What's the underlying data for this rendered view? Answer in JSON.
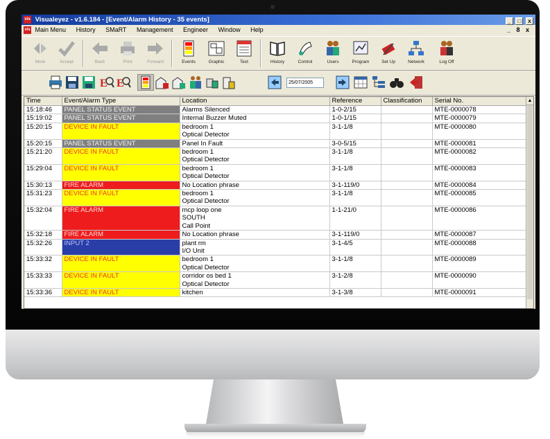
{
  "window": {
    "title": "Visualeyez - v1.6.184 - [Event/Alarm History - 35 events]",
    "app_badge": "vis",
    "buttons": [
      "_",
      "□",
      "x"
    ]
  },
  "menu": {
    "items": [
      "Main Menu",
      "History",
      "SMaRT",
      "Management",
      "Engineer",
      "Window",
      "Help"
    ],
    "mdi_controls": "_ 8 x"
  },
  "toolbar_main": [
    {
      "label": "Mute",
      "icon": "mute-icon",
      "enabled": false
    },
    {
      "label": "Accept",
      "icon": "checkmark-icon",
      "enabled": false
    },
    {
      "label": "Back",
      "icon": "arrow-left-icon",
      "enabled": false
    },
    {
      "label": "Print",
      "icon": "printer-icon",
      "enabled": false
    },
    {
      "label": "Forward",
      "icon": "arrow-right-icon",
      "enabled": false
    },
    {
      "label": "Events",
      "icon": "events-icon",
      "enabled": true
    },
    {
      "label": "Graphic",
      "icon": "graphic-icon",
      "enabled": true
    },
    {
      "label": "Text",
      "icon": "text-icon",
      "enabled": true
    },
    {
      "label": "History",
      "icon": "book-icon",
      "enabled": true
    },
    {
      "label": "Control",
      "icon": "control-icon",
      "enabled": true
    },
    {
      "label": "Users",
      "icon": "users-icon",
      "enabled": true
    },
    {
      "label": "Program",
      "icon": "program-icon",
      "enabled": true
    },
    {
      "label": "Set Up",
      "icon": "setup-icon",
      "enabled": true
    },
    {
      "label": "Network",
      "icon": "network-icon",
      "enabled": true
    },
    {
      "label": "Log Off",
      "icon": "logoff-icon",
      "enabled": true
    }
  ],
  "toolbar_history": {
    "date": "25/07/2005"
  },
  "grid": {
    "columns": [
      "Time",
      "Event/Alarm Type",
      "Location",
      "Reference",
      "Classification",
      "Serial No."
    ],
    "rows": [
      {
        "time": "15:18:46",
        "type": "PANEL STATUS EVENT",
        "kind": "panel",
        "location": [
          "Alarms Silenced"
        ],
        "reference": "1-0-2/15",
        "classification": "",
        "serial": "MTE-0000078"
      },
      {
        "time": "15:19:02",
        "type": "PANEL STATUS EVENT",
        "kind": "panel",
        "location": [
          "Internal Buzzer Muted"
        ],
        "reference": "1-0-1/15",
        "classification": "",
        "serial": "MTE-0000079"
      },
      {
        "time": "15:20:15",
        "type": "DEVICE IN FAULT",
        "kind": "fault",
        "location": [
          "bedroom 1",
          "Optical Detector"
        ],
        "reference": "3-1-1/8",
        "classification": "",
        "serial": "MTE-0000080"
      },
      {
        "time": "15:20:15",
        "type": "PANEL STATUS EVENT",
        "kind": "panel",
        "location": [
          "Panel In Fault"
        ],
        "reference": "3-0-5/15",
        "classification": "",
        "serial": "MTE-0000081"
      },
      {
        "time": "15:21:20",
        "type": "DEVICE IN FAULT",
        "kind": "fault",
        "location": [
          "bedroom 1",
          "Optical Detector"
        ],
        "reference": "3-1-1/8",
        "classification": "",
        "serial": "MTE-0000082"
      },
      {
        "time": "15:29:04",
        "type": "DEVICE IN FAULT",
        "kind": "fault",
        "location": [
          "bedroom 1",
          "Optical Detector"
        ],
        "reference": "3-1-1/8",
        "classification": "",
        "serial": "MTE-0000083"
      },
      {
        "time": "15:30:13",
        "type": "FIRE ALARM",
        "kind": "fire",
        "location": [
          "No Location phrase"
        ],
        "reference": "3-1-119/0",
        "classification": "",
        "serial": "MTE-0000084"
      },
      {
        "time": "15:31:23",
        "type": "DEVICE IN FAULT",
        "kind": "fault",
        "location": [
          "bedroom 1",
          "Optical Detector"
        ],
        "reference": "3-1-1/8",
        "classification": "",
        "serial": "MTE-0000085"
      },
      {
        "time": "15:32:04",
        "type": "FIRE ALARM",
        "kind": "fire",
        "location": [
          "mcp loop one",
          "SOUTH",
          "Call Point"
        ],
        "reference": "1-1-21/0",
        "classification": "",
        "serial": "MTE-0000086"
      },
      {
        "time": "15:32:18",
        "type": "FIRE ALARM",
        "kind": "fire",
        "location": [
          "No Location phrase"
        ],
        "reference": "3-1-119/0",
        "classification": "",
        "serial": "MTE-0000087"
      },
      {
        "time": "15:32:26",
        "type": "INPUT 2",
        "kind": "input",
        "location": [
          "plant rm",
          "I/O Unit"
        ],
        "reference": "3-1-4/5",
        "classification": "",
        "serial": "MTE-0000088"
      },
      {
        "time": "15:33:32",
        "type": "DEVICE IN FAULT",
        "kind": "fault",
        "location": [
          "bedroom 1",
          "Optical Detector"
        ],
        "reference": "3-1-1/8",
        "classification": "",
        "serial": "MTE-0000089"
      },
      {
        "time": "15:33:33",
        "type": "DEVICE IN FAULT",
        "kind": "fault",
        "location": [
          "corridor os bed 1",
          "Optical Detector"
        ],
        "reference": "3-1-2/8",
        "classification": "",
        "serial": "MTE-0000090"
      },
      {
        "time": "15:33:36",
        "type": "DEVICE IN FAULT",
        "kind": "fault",
        "location": [
          "kitchen"
        ],
        "reference": "3-1-3/8",
        "classification": "",
        "serial": "MTE-0000091"
      }
    ]
  },
  "colors": {
    "panel": "#7f7f7f",
    "fault": "#ffff00",
    "fire": "#ee1c1c",
    "input": "#2a3ea8",
    "titlebar": "#123a9c"
  }
}
